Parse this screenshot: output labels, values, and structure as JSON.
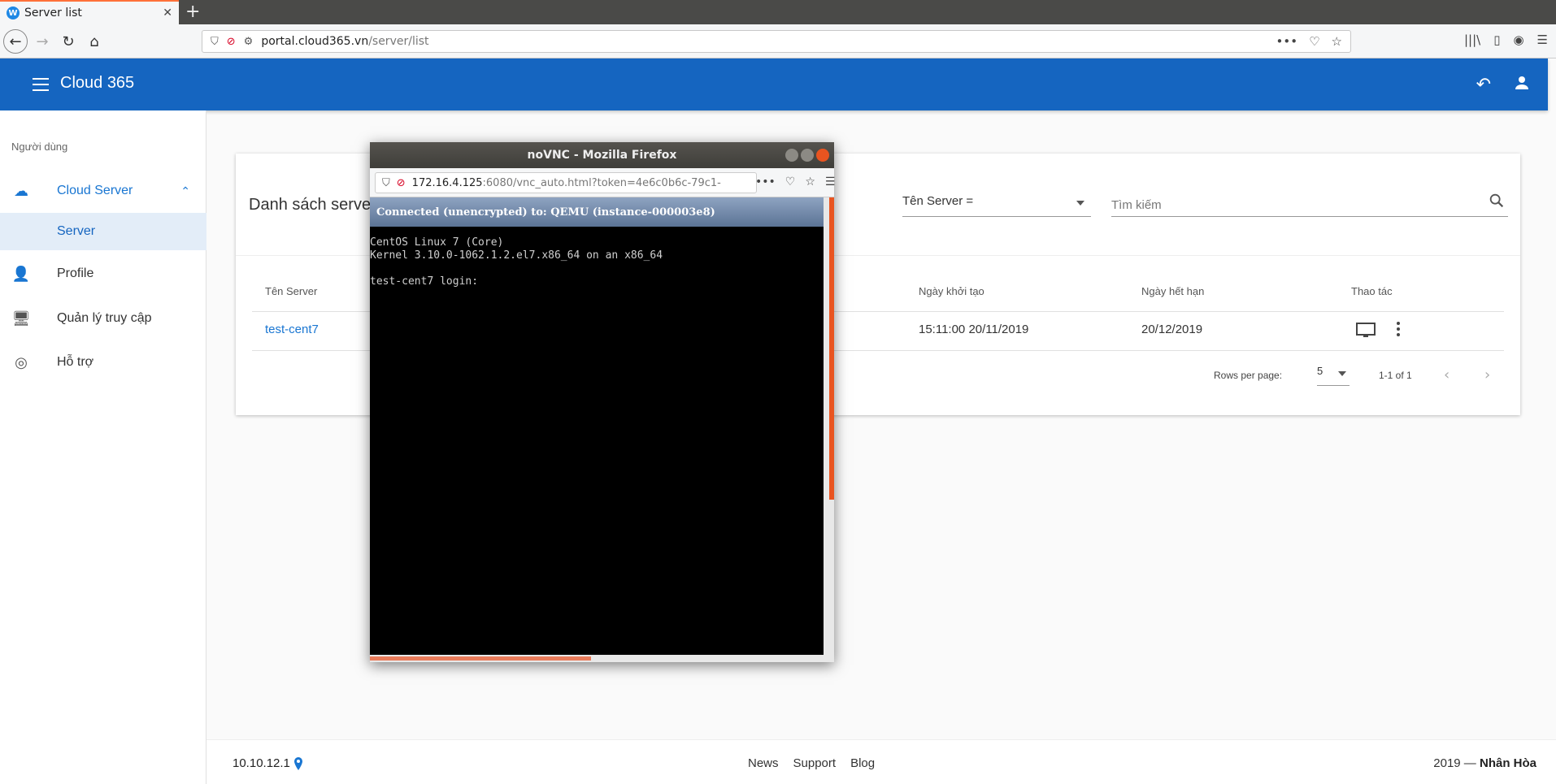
{
  "browser": {
    "tab_title": "Server list",
    "favicon_letter": "W",
    "close_glyph": "✕",
    "newtab_glyph": "+",
    "url_host": "portal.cloud365.vn",
    "url_path": "/server/list",
    "back_glyph": "←",
    "forward_glyph": "→",
    "reload_glyph": "↻",
    "home_glyph": "⌂",
    "more_glyph": "•••",
    "pocket_glyph": "♡",
    "star_glyph": "☆",
    "library_glyph": "|||\\",
    "sidebar_glyph": "▯",
    "account_glyph": "◉",
    "menu_glyph": "☰"
  },
  "app": {
    "title": "Cloud 365",
    "undo_glyph": "↶"
  },
  "sidebar": {
    "section_label": "Người dùng",
    "items": [
      {
        "label": "Cloud Server",
        "icon": "☁"
      },
      {
        "label": "Server"
      },
      {
        "label": "Profile",
        "icon": "👤"
      },
      {
        "label": "Quản lý truy cập",
        "icon": "🖥"
      },
      {
        "label": "Hỗ trợ",
        "icon": "◎"
      }
    ],
    "chevron": "⌃"
  },
  "card": {
    "title": "Danh sách serve",
    "filter_value": "Tên Server =",
    "search_placeholder": "Tìm kiếm",
    "columns": [
      "Tên Server",
      "Ngày khởi tạo",
      "Ngày hết hạn",
      "Thao tác"
    ],
    "rows": [
      {
        "name": "test-cent7",
        "created": "15:11:00 20/11/2019",
        "expires": "20/12/2019"
      }
    ],
    "pager": {
      "rows_per_page_label": "Rows per page:",
      "rows_per_page": "5",
      "range": "1-1 of 1",
      "prev": "‹",
      "next": "›"
    }
  },
  "footer": {
    "ip": "10.10.12.1",
    "links": [
      "News",
      "Support",
      "Blog"
    ],
    "copy_year": "2019 —",
    "copy_brand": "Nhân Hòa"
  },
  "vnc": {
    "window_title": "noVNC - Mozilla Firefox",
    "url_host": "172.16.4.125",
    "url_rest": ":6080/vnc_auto.html?token=4e6c0b6c-79c1-",
    "status": "Connected (unencrypted) to: QEMU (instance-000003e8)",
    "console_lines": [
      "CentOS Linux 7 (Core)",
      "Kernel 3.10.0-1062.1.2.el7.x86_64 on an x86_64",
      "",
      "test-cent7 login:"
    ]
  }
}
